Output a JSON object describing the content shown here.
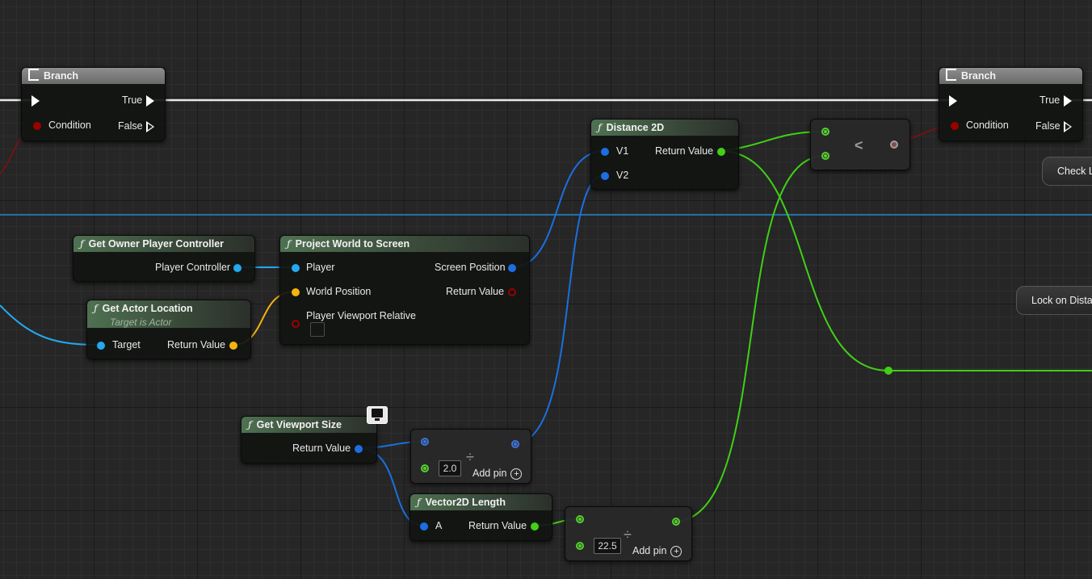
{
  "nodes": {
    "branch_left": {
      "title": "Branch",
      "pins": {
        "condition": "Condition",
        "true": "True",
        "false": "False"
      }
    },
    "branch_right": {
      "title": "Branch",
      "pins": {
        "condition": "Condition",
        "true": "True",
        "false": "False"
      }
    },
    "distance_2d": {
      "title": "Distance 2D",
      "pins": {
        "v1": "V1",
        "v2": "V2",
        "return": "Return Value"
      }
    },
    "less_than": {
      "operator": "<"
    },
    "get_owner_player_controller": {
      "title": "Get Owner Player Controller",
      "pins": {
        "out": "Player Controller"
      }
    },
    "project_world_to_screen": {
      "title": "Project World to Screen",
      "pins": {
        "player": "Player",
        "world_position": "World Position",
        "player_viewport_relative": "Player Viewport Relative",
        "screen_position": "Screen Position",
        "return": "Return Value"
      }
    },
    "get_actor_location": {
      "title": "Get Actor Location",
      "subtitle": "Target is Actor",
      "pins": {
        "target": "Target",
        "return": "Return Value"
      }
    },
    "get_viewport_size": {
      "title": "Get Viewport Size",
      "pins": {
        "return": "Return Value"
      }
    },
    "divide_1": {
      "operator": "÷",
      "value": "2.0",
      "add_pin": "Add pin"
    },
    "vector2d_length": {
      "title": "Vector2D Length",
      "pins": {
        "a": "A",
        "return": "Return Value"
      }
    },
    "divide_2": {
      "operator": "÷",
      "value": "22.5",
      "add_pin": "Add pin"
    }
  },
  "events": {
    "check": "Check L",
    "lock_on": "Lock on Dista"
  },
  "icons": {
    "function": "ƒ",
    "add": "+"
  },
  "colors": {
    "exec": "#ffffff",
    "bool": "#9a0000",
    "vector2d": "#1b6fe0",
    "object": "#23a9f0",
    "vector": "#f5b40f",
    "float": "#40d016",
    "function_header": "#4f7152",
    "flow_header": "#7a7a7a"
  }
}
